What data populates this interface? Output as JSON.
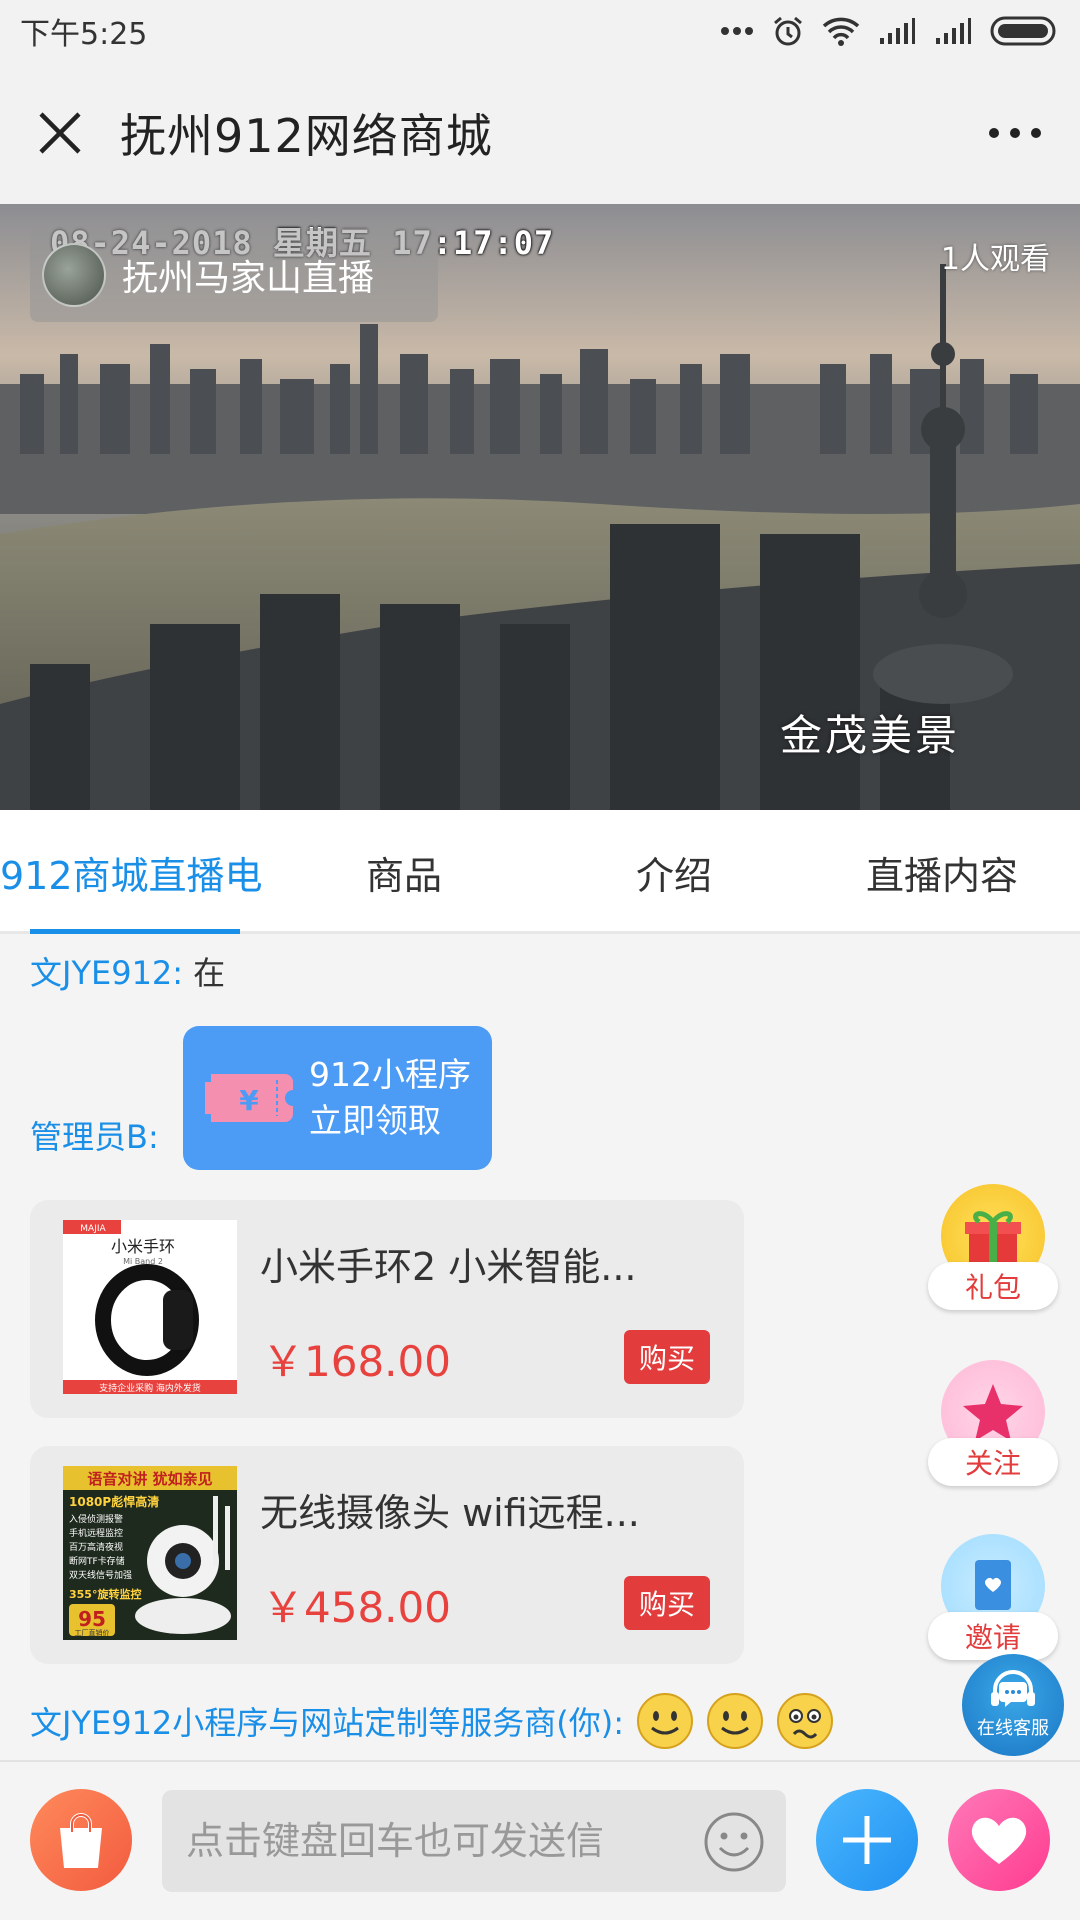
{
  "status_bar": {
    "time": "下午5:25"
  },
  "header": {
    "title": "抚州912网络商城"
  },
  "video": {
    "timestamp": "08-24-2018 星期五 17:17:07",
    "channel_name": "抚州马家山直播",
    "viewer_count": "1人观看",
    "caption": "金茂美景"
  },
  "tabs": [
    {
      "label": "912商城直播电"
    },
    {
      "label": "商品"
    },
    {
      "label": "介绍"
    },
    {
      "label": "直播内容"
    }
  ],
  "chat": {
    "msg1": {
      "user": "文JYE912:",
      "text": "在"
    },
    "msg2": {
      "user": "管理员B:",
      "coupon_line1": "912小程序",
      "coupon_line2": "立即领取"
    },
    "products": [
      {
        "name": "小米手环2 小米智能...",
        "price": "￥168.00",
        "buy_label": "购买",
        "thumb_brand": "MAJIA",
        "thumb_title": "小米手环",
        "thumb_sub": "Mi Band 2",
        "thumb_footer": "支持企业采购  海内外发货"
      },
      {
        "name": "无线摄像头 wifi远程...",
        "price": "￥458.00",
        "buy_label": "购买",
        "thumb_banner": "语音对讲 犹如亲见",
        "thumb_res": "1080P彪悍高清",
        "thumb_features": [
          "入侵侦测报警",
          "手机远程监控",
          "百万高清夜视",
          "断网TF卡存储",
          "双天线信号加强"
        ],
        "thumb_rotate": "355°旋转监控",
        "thumb_price": "95",
        "thumb_note": "工厂直销价"
      }
    ],
    "msg3": {
      "user": "文JYE912小程序与网站定制等服务商(你):"
    }
  },
  "side_buttons": [
    {
      "label": "礼包"
    },
    {
      "label": "关注"
    },
    {
      "label": "邀请"
    }
  ],
  "service": {
    "label": "在线客服"
  },
  "bottom_bar": {
    "input_placeholder": "点击键盘回车也可发送信"
  },
  "colors": {
    "accent": "#1a8fe8",
    "price": "#e8423e",
    "buy": "#e23c3c"
  }
}
